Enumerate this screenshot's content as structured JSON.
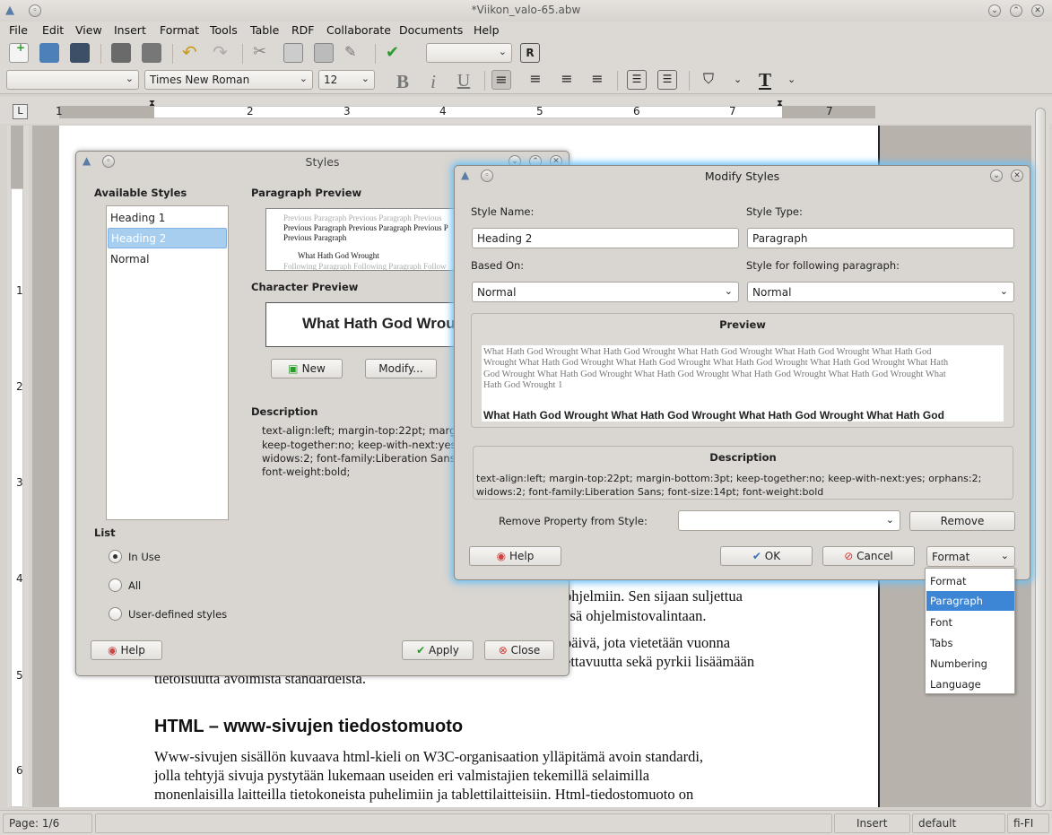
{
  "window": {
    "title": "*Viikon_valo-65.abw"
  },
  "menu": [
    "File",
    "Edit",
    "View",
    "Insert",
    "Format",
    "Tools",
    "Table",
    "RDF",
    "Collaborate",
    "Documents",
    "Help"
  ],
  "toolbar": {
    "style_combo": "",
    "font_combo": "Times New Roman",
    "size_combo": "12"
  },
  "ruler": {
    "h_numbers": [
      "1",
      "1",
      "2",
      "3",
      "4",
      "5",
      "6",
      "7"
    ],
    "v_numbers": [
      "1",
      "2",
      "3",
      "4",
      "5",
      "6"
    ]
  },
  "document": {
    "paragraphs": [
      "ohjelmiin. Sen sijaan suljettua",
      "ssä ohjelmistovalintaan.",
      "päivä, jota vietetään vuonna",
      "ettavuutta sekä pyrkii lisäämään",
      "tietoisuutta avoimista standardeista."
    ],
    "heading": "HTML – www-sivujen tiedostomuoto",
    "body": [
      "Www-sivujen sisällön kuvaava html-kieli on W3C-organisaation ylläpitämä avoin standardi,",
      "jolla tehtyjä sivuja pystytään lukemaan useiden eri valmistajien tekemillä selaimilla",
      "monenlaisilla laitteilla tietokoneista puhelimiin ja tablettilaitteisiin. Html-tiedostomuoto on"
    ]
  },
  "status": {
    "page": "Page: 1/6",
    "mode": "Insert",
    "lang_default": "default",
    "lang": "fi-FI"
  },
  "styles_dialog": {
    "title": "Styles",
    "available_label": "Available Styles",
    "styles": [
      "Heading 1",
      "Heading 2",
      "Normal"
    ],
    "selected_style": "Heading 2",
    "paragraph_preview_label": "Paragraph Preview",
    "pp_prev1": "Previous Paragraph  Previous Paragraph  Previous",
    "pp_prev2": "Previous Paragraph  Previous Paragraph  Previous P",
    "pp_prev3": "Previous Paragraph",
    "pp_main": "What Hath God Wrought",
    "pp_follow": "Following Paragraph  Following Paragraph  Follow",
    "char_preview_label": "Character Preview",
    "char_preview_text": "What Hath God Wrou",
    "new_button": "New",
    "modify_button": "Modify...",
    "description_label": "Description",
    "description_lines": [
      "text-align:left; margin-top:22pt; marg",
      "keep-together:no; keep-with-next:yes",
      "widows:2; font-family:Liberation Sans;",
      "font-weight:bold;"
    ],
    "list_label": "List",
    "list_options": [
      "In Use",
      "All",
      "User-defined styles"
    ],
    "list_selected": "In Use",
    "help_button": "Help",
    "apply_button": "Apply",
    "close_button": "Close"
  },
  "modify_dialog": {
    "title": "Modify Styles",
    "style_name_label": "Style Name:",
    "style_name_value": "Heading 2",
    "style_type_label": "Style Type:",
    "style_type_value": "Paragraph",
    "based_on_label": "Based On:",
    "based_on_value": "Normal",
    "following_label": "Style for following paragraph:",
    "following_value": "Normal",
    "preview_label": "Preview",
    "preview_lines": [
      "What Hath God Wrought  What Hath God Wrought  What Hath God Wrought  What Hath God Wrought  What Hath God",
      "Wrought  What Hath God Wrought  What Hath God Wrought  What Hath God Wrought  What Hath God Wrought  What Hath",
      "God Wrought  What Hath God Wrought  What Hath God Wrought  What Hath God Wrought  What Hath God Wrought  What",
      "Hath God Wrought   1"
    ],
    "preview_heading": "What Hath God Wrought  What Hath God Wrought  What Hath God Wrought  What Hath God",
    "description_label": "Description",
    "description_lines": [
      "text-align:left; margin-top:22pt; margin-bottom:3pt; keep-together:no; keep-with-next:yes; orphans:2;",
      "widows:2; font-family:Liberation Sans; font-size:14pt; font-weight:bold"
    ],
    "remove_label": "Remove Property from Style:",
    "remove_value": "",
    "remove_button": "Remove",
    "help_button": "Help",
    "ok_button": "OK",
    "cancel_button": "Cancel",
    "format_value": "Format",
    "format_options": [
      "Format",
      "Paragraph",
      "Font",
      "Tabs",
      "Numbering",
      "Language"
    ],
    "format_highlighted": "Paragraph"
  },
  "colors": {
    "selection": "#a7cdef",
    "accent": "#3d86d6",
    "glow": "#6ec1f5"
  }
}
